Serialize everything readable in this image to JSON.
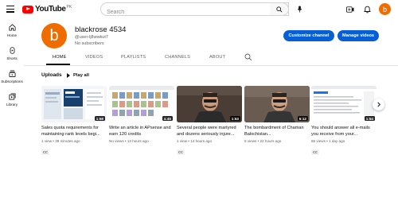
{
  "header": {
    "logo_text": "YouTube",
    "logo_country": "PK",
    "search_placeholder": "Search",
    "avatar_letter": "b"
  },
  "sidebar": {
    "items": [
      {
        "label": "Home",
        "icon": "home-icon"
      },
      {
        "label": "Shorts",
        "icon": "shorts-icon"
      },
      {
        "label": "Subscriptions",
        "icon": "subscriptions-icon"
      },
      {
        "label": "Library",
        "icon": "library-icon"
      }
    ]
  },
  "channel": {
    "avatar_letter": "b",
    "name": "blackrose 4534",
    "handle": "@user-lj8wwkut7",
    "subscribers": "No subscribers",
    "customize_label": "Customize channel",
    "manage_label": "Manage videos"
  },
  "tabs": [
    "HOME",
    "VIDEOS",
    "PLAYLISTS",
    "CHANNELS",
    "ABOUT"
  ],
  "uploads": {
    "title": "Uploads",
    "play_all_label": "Play all"
  },
  "videos": [
    {
      "title": "Sales quota requirements for maintaining rank levels begi...",
      "views": "1 view",
      "age": "38 minutes ago",
      "duration": "1:58",
      "cc": "CC"
    },
    {
      "title": "Write an article in APsense and earn 120 credits",
      "views": "No views",
      "age": "13 hours ago",
      "duration": "4:45",
      "cc": ""
    },
    {
      "title": "Several people were martyred and dozens seriously injure...",
      "views": "1 view",
      "age": "14 hours ago",
      "duration": "1:53",
      "cc": "CC"
    },
    {
      "title": "The bombardment of Chaman Balochistan...",
      "views": "5 views",
      "age": "22 hours ago",
      "duration": "6:12",
      "cc": ""
    },
    {
      "title": "You should answer all e-mails you receive from your...",
      "views": "66 views",
      "age": "1 day ago",
      "duration": "1:54",
      "cc": "CC"
    }
  ],
  "colors": {
    "brand_red": "#ff0000",
    "accent_blue": "#065fd4",
    "avatar_orange": "#ef6c00"
  }
}
